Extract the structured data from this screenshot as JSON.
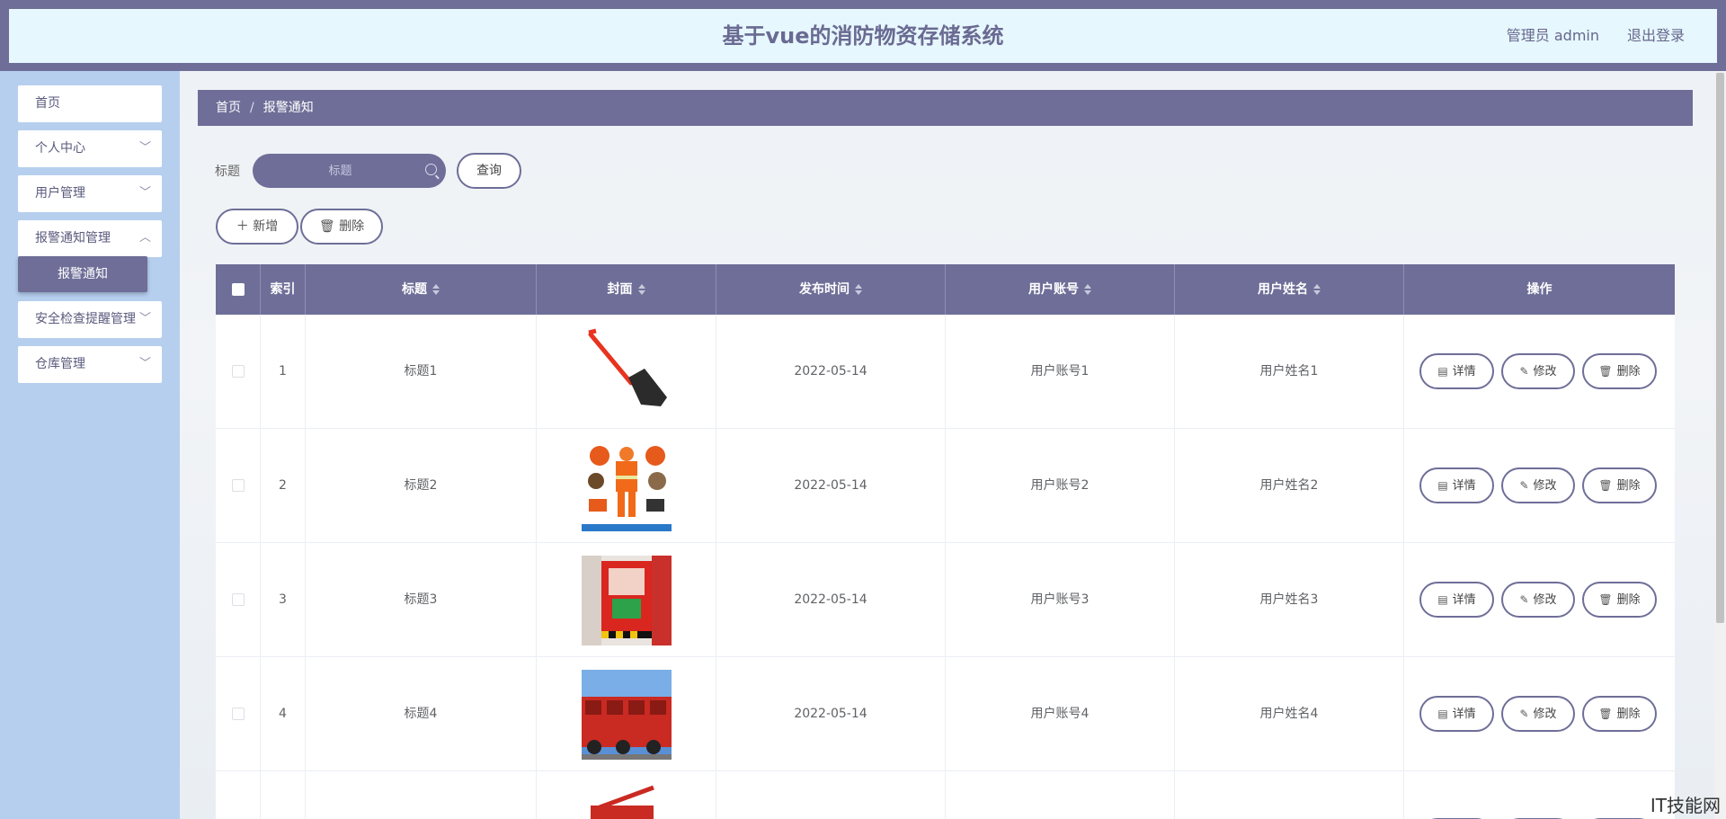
{
  "header": {
    "title": "基于vue的消防物资存储系统",
    "user": "管理员 admin",
    "logout": "退出登录"
  },
  "sidebar": {
    "items": [
      {
        "label": "首页"
      },
      {
        "label": "个人中心"
      },
      {
        "label": "用户管理"
      },
      {
        "label": "报警通知管理"
      },
      {
        "label": "安全检查提醒管理"
      },
      {
        "label": "仓库管理"
      }
    ],
    "active_sub": "报警通知"
  },
  "breadcrumb": {
    "home": "首页",
    "separator": "/",
    "current": "报警通知"
  },
  "search": {
    "label": "标题",
    "placeholder": "标题",
    "query_button": "查询"
  },
  "actions": {
    "add": "新增",
    "delete": "删除"
  },
  "table": {
    "columns": [
      "索引",
      "标题",
      "封面",
      "发布时间",
      "用户账号",
      "用户姓名",
      "操作"
    ],
    "rows": [
      {
        "index": "1",
        "title": "标题1",
        "cover": "shovel",
        "date": "2022-05-14",
        "account": "用户账号1",
        "name": "用户姓名1"
      },
      {
        "index": "2",
        "title": "标题2",
        "cover": "fire-suit",
        "date": "2022-05-14",
        "account": "用户账号2",
        "name": "用户姓名2"
      },
      {
        "index": "3",
        "title": "标题3",
        "cover": "fire-cabinet",
        "date": "2022-05-14",
        "account": "用户账号3",
        "name": "用户姓名3"
      },
      {
        "index": "4",
        "title": "标题4",
        "cover": "fire-trucks",
        "date": "2022-05-14",
        "account": "用户账号4",
        "name": "用户姓名4"
      }
    ],
    "row_actions": {
      "detail": "详情",
      "edit": "修改",
      "delete": "删除"
    }
  },
  "watermark": "IT技能网",
  "colors": {
    "primary": "#6e6e98",
    "sidebar_bg": "#b6cfee",
    "header_inner": "#e6f7fd"
  }
}
